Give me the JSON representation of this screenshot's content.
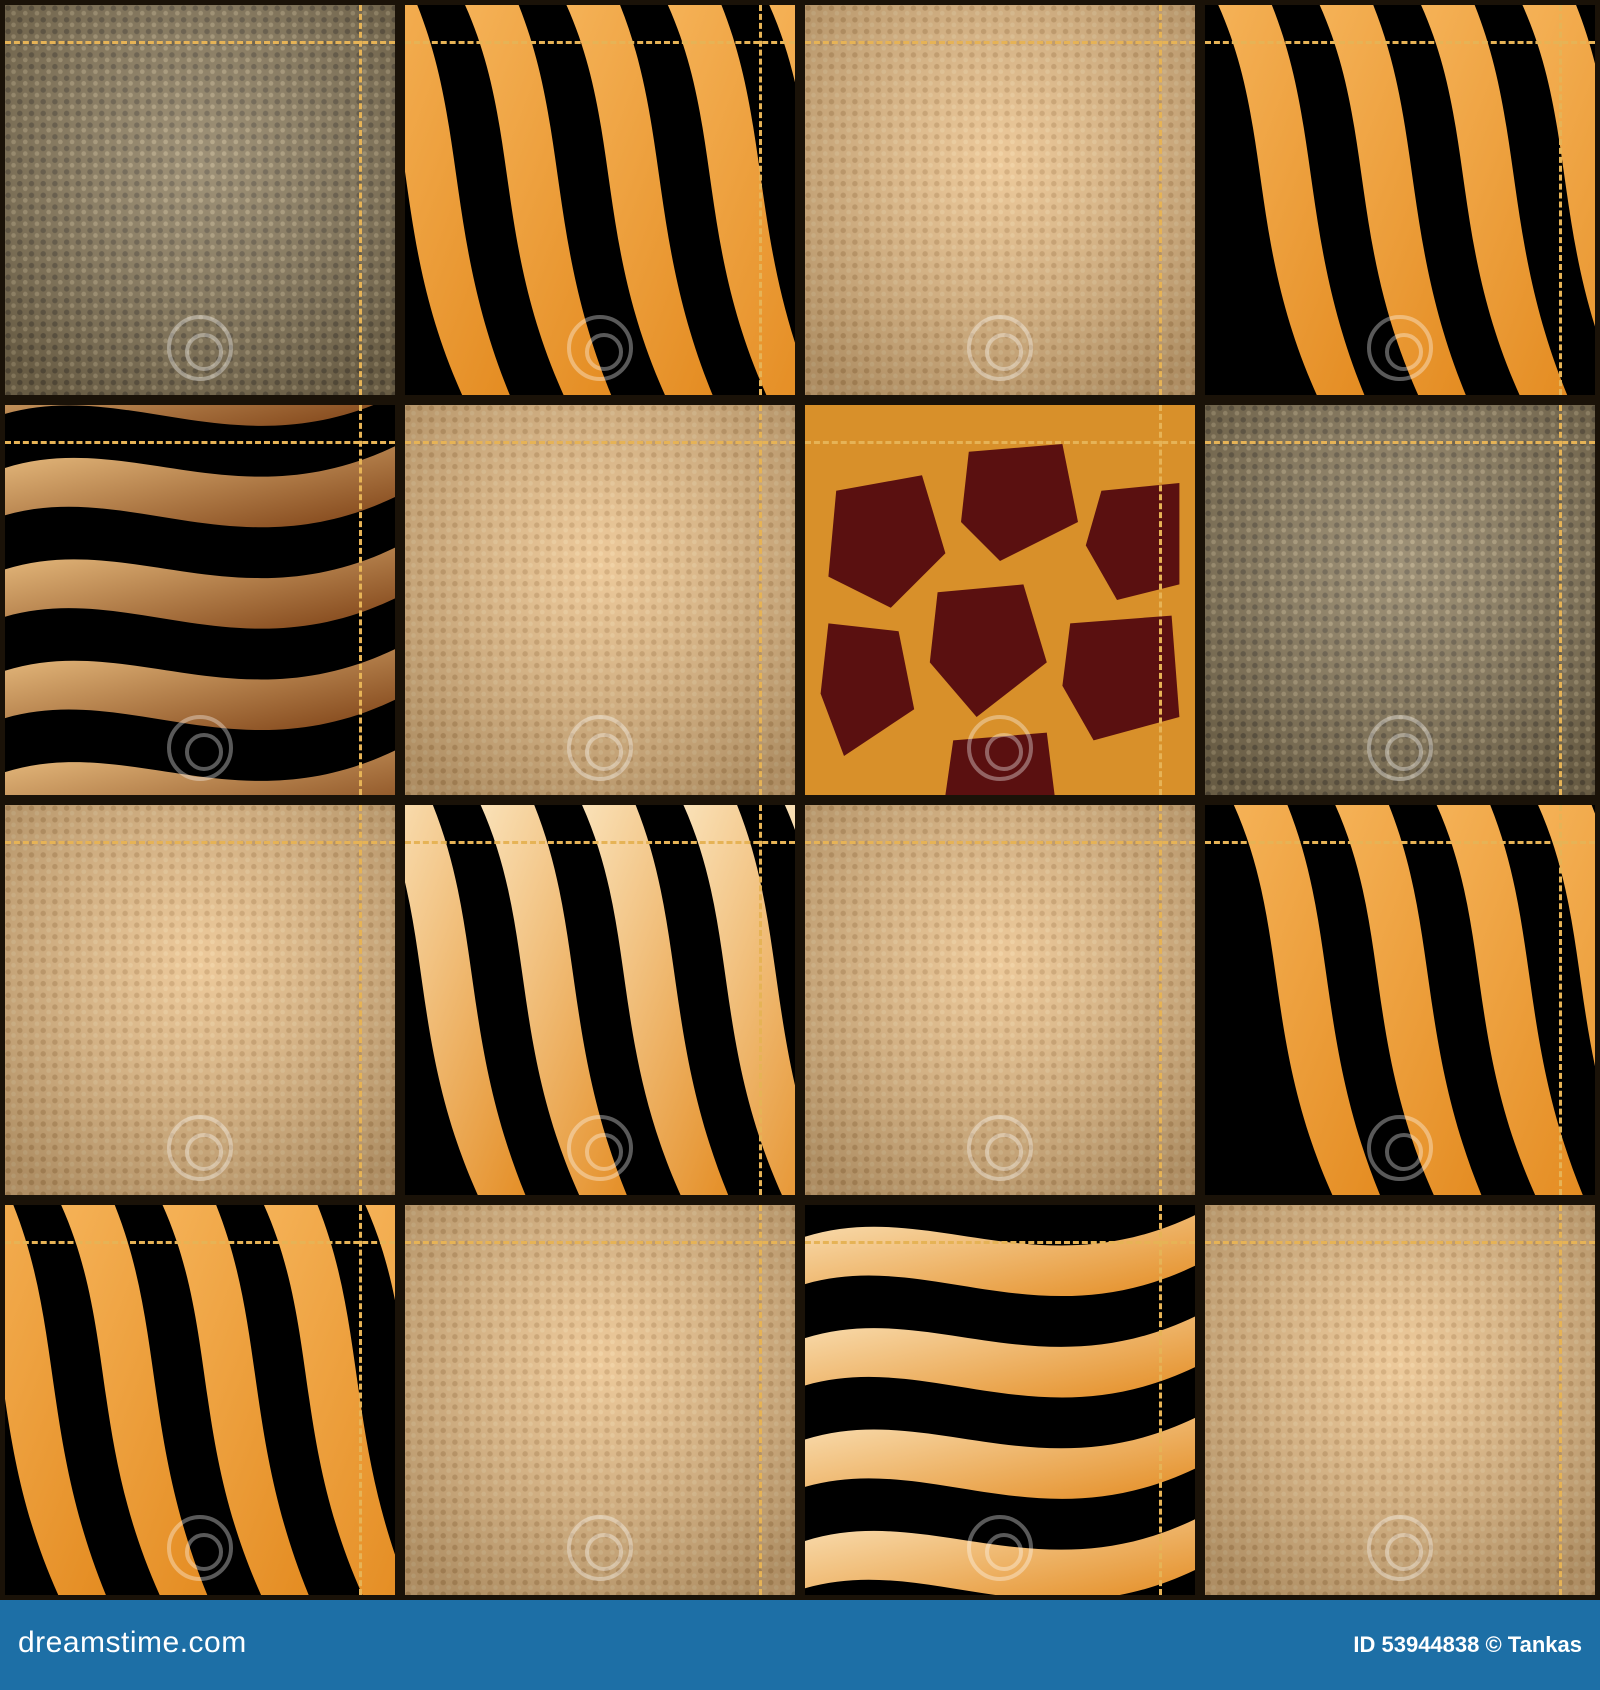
{
  "watermark": {
    "brand": "dreamstime.com",
    "stock_id": "ID 53944838 © Tankas"
  },
  "palette": {
    "canvas_light": "#e9be85",
    "canvas_dark": "#8a7a5a",
    "stitch": "#e6b356",
    "stripe_black": "#000000",
    "stripe_amber": "#e38a1f",
    "stripe_cream": "#fbe6c0",
    "giraffe_spot": "#5a1010",
    "giraffe_line": "#d8902a",
    "footer": "#1d6fa6"
  },
  "grid": {
    "rows": 4,
    "cols": 4,
    "tiles": [
      [
        "canvas-gray",
        "zebra-amber",
        "canvas-light",
        "tiger-amber"
      ],
      [
        "zebra-brown",
        "canvas-light",
        "giraffe",
        "canvas-gray"
      ],
      [
        "canvas-light",
        "zebra-cream",
        "canvas-light",
        "tiger-amber"
      ],
      [
        "tiger-amber",
        "canvas-light",
        "zebra-cream",
        "canvas-light"
      ]
    ]
  }
}
